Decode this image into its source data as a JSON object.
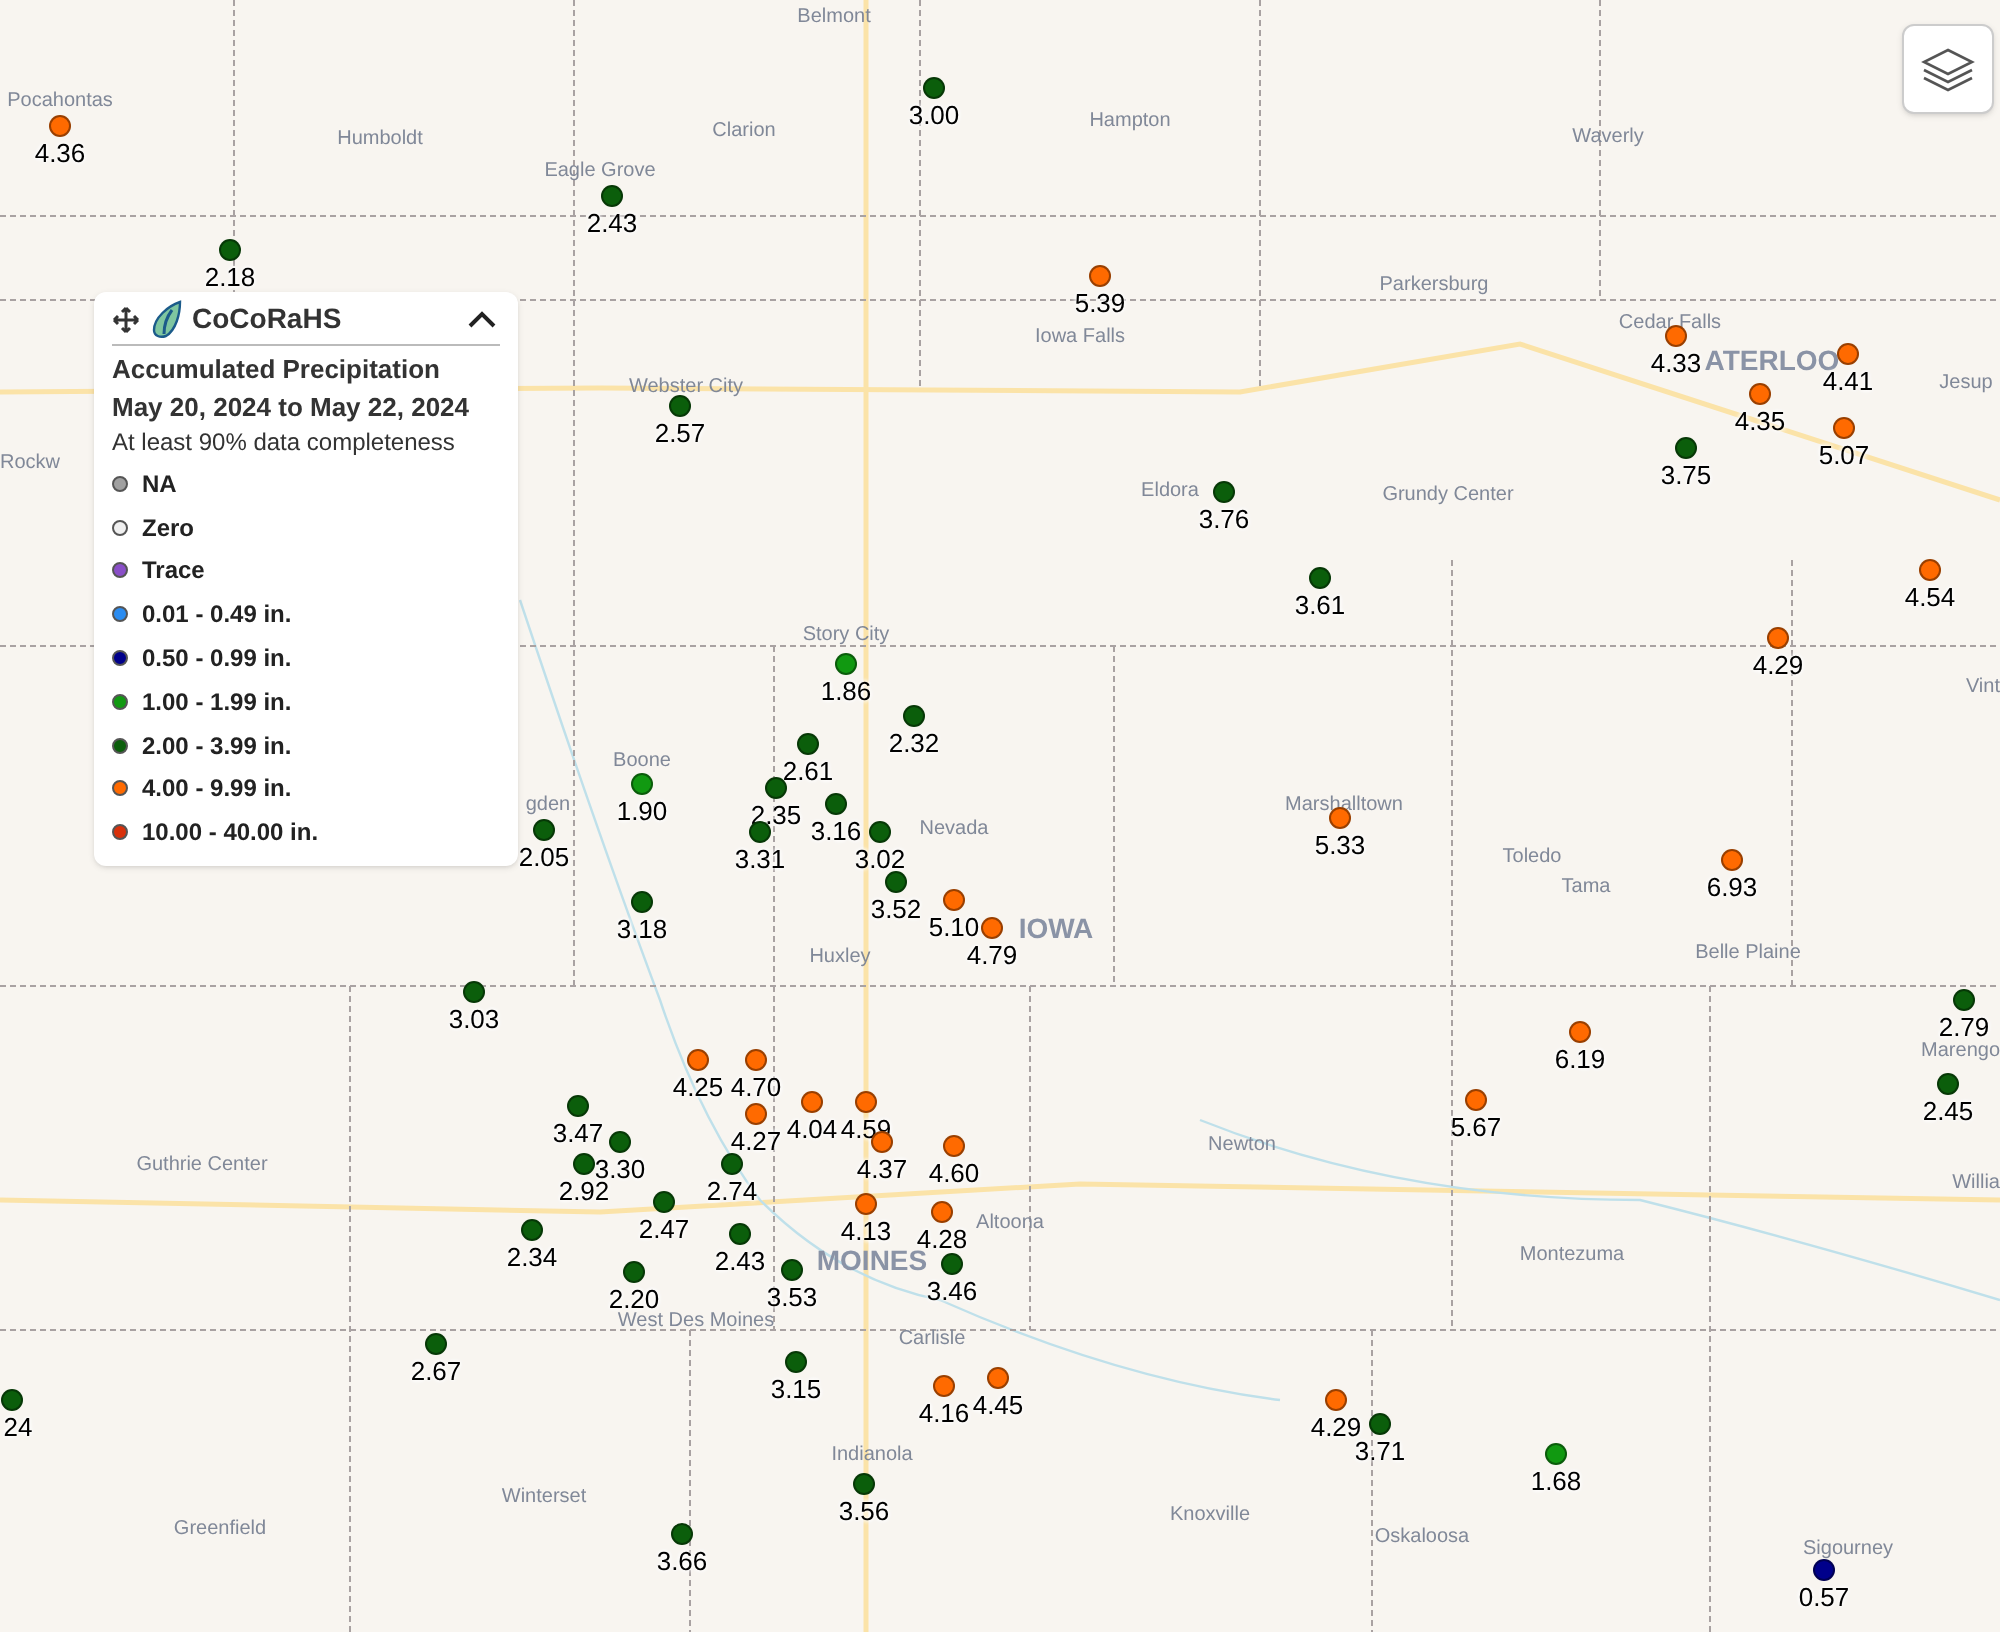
{
  "legend": {
    "brand": "CoCoRaHS",
    "expanded": true,
    "title": "Accumulated Precipitation",
    "dates": "May 20, 2024 to May 22, 2024",
    "note": "At least 90% data completeness",
    "items": [
      {
        "label": "NA",
        "color": "#a0a0a0"
      },
      {
        "label": "Zero",
        "color": "#f0f0f0"
      },
      {
        "label": "Trace",
        "color": "#8a4fc8"
      },
      {
        "label": "0.01 - 0.49 in.",
        "color": "#2b8cf0"
      },
      {
        "label": "0.50 - 0.99 in.",
        "color": "#00008b"
      },
      {
        "label": "1.00 - 1.99 in.",
        "color": "#119911"
      },
      {
        "label": "2.00 - 3.99 in.",
        "color": "#0b5e0b"
      },
      {
        "label": "4.00 - 9.99 in.",
        "color": "#ff6a00"
      },
      {
        "label": "10.00 - 40.00 in.",
        "color": "#d8300a"
      }
    ]
  },
  "towns": [
    {
      "name": "Belmont",
      "kind": "town"
    },
    {
      "name": "Pocahontas",
      "kind": "town"
    },
    {
      "name": "Humboldt",
      "kind": "town"
    },
    {
      "name": "Clarion",
      "kind": "town"
    },
    {
      "name": "Hampton",
      "kind": "town"
    },
    {
      "name": "Waverly",
      "kind": "town"
    },
    {
      "name": "Eagle Grove",
      "kind": "town"
    },
    {
      "name": "Parkersburg",
      "kind": "town"
    },
    {
      "name": "Iowa Falls",
      "kind": "town"
    },
    {
      "name": "Cedar Falls",
      "kind": "town"
    },
    {
      "name": "ATERLOO",
      "kind": "city"
    },
    {
      "name": "Webster City",
      "kind": "town"
    },
    {
      "name": "Jesup",
      "kind": "town"
    },
    {
      "name": "Rockw",
      "kind": "town"
    },
    {
      "name": "Eldora",
      "kind": "town"
    },
    {
      "name": "Grundy Center",
      "kind": "town"
    },
    {
      "name": "Story City",
      "kind": "town"
    },
    {
      "name": "Vint",
      "kind": "town"
    },
    {
      "name": "Boone",
      "kind": "town"
    },
    {
      "name": "gden",
      "kind": "town"
    },
    {
      "name": "Nevada",
      "kind": "town"
    },
    {
      "name": "Marshalltown",
      "kind": "town"
    },
    {
      "name": "Toledo",
      "kind": "town"
    },
    {
      "name": "Tama",
      "kind": "town"
    },
    {
      "name": "IOWA",
      "kind": "city"
    },
    {
      "name": "Huxley",
      "kind": "town"
    },
    {
      "name": "Belle Plaine",
      "kind": "town"
    },
    {
      "name": "Marengo",
      "kind": "town"
    },
    {
      "name": "Guthrie Center",
      "kind": "town"
    },
    {
      "name": "Newton",
      "kind": "town"
    },
    {
      "name": "Willia",
      "kind": "town"
    },
    {
      "name": "Altoona",
      "kind": "town"
    },
    {
      "name": "MOINES",
      "kind": "city"
    },
    {
      "name": "Montezuma",
      "kind": "town"
    },
    {
      "name": "West Des Moines",
      "kind": "town"
    },
    {
      "name": "Carlisle",
      "kind": "town"
    },
    {
      "name": "Indianola",
      "kind": "town"
    },
    {
      "name": "Winterset",
      "kind": "town"
    },
    {
      "name": "Greenfield",
      "kind": "town"
    },
    {
      "name": "Knoxville",
      "kind": "town"
    },
    {
      "name": "Oskaloosa",
      "kind": "town"
    },
    {
      "name": "Sigourney",
      "kind": "town"
    }
  ],
  "stations": [
    {
      "value": "3.00",
      "color": "#0b5e0b"
    },
    {
      "value": "4.36",
      "color": "#ff6a00"
    },
    {
      "value": "2.43",
      "color": "#0b5e0b"
    },
    {
      "value": "2.18",
      "color": "#0b5e0b"
    },
    {
      "value": "5.39",
      "color": "#ff6a00"
    },
    {
      "value": "4.33",
      "color": "#ff6a00"
    },
    {
      "value": "4.41",
      "color": "#ff6a00"
    },
    {
      "value": "2.57",
      "color": "#0b5e0b"
    },
    {
      "value": "4.35",
      "color": "#ff6a00"
    },
    {
      "value": "3.75",
      "color": "#0b5e0b"
    },
    {
      "value": "5.07",
      "color": "#ff6a00"
    },
    {
      "value": "3.76",
      "color": "#0b5e0b"
    },
    {
      "value": "3.61",
      "color": "#0b5e0b"
    },
    {
      "value": "4.54",
      "color": "#ff6a00"
    },
    {
      "value": "4.29",
      "color": "#ff6a00"
    },
    {
      "value": "1.86",
      "color": "#119911"
    },
    {
      "value": "2.32",
      "color": "#0b5e0b"
    },
    {
      "value": "2.61",
      "color": "#0b5e0b"
    },
    {
      "value": "1.90",
      "color": "#119911"
    },
    {
      "value": "2.35",
      "color": "#0b5e0b"
    },
    {
      "value": "2.05",
      "color": "#0b5e0b"
    },
    {
      "value": "3.31",
      "color": "#0b5e0b"
    },
    {
      "value": "3.16",
      "color": "#0b5e0b"
    },
    {
      "value": "3.02",
      "color": "#0b5e0b"
    },
    {
      "value": "5.33",
      "color": "#ff6a00"
    },
    {
      "value": "6.93",
      "color": "#ff6a00"
    },
    {
      "value": "3.52",
      "color": "#0b5e0b"
    },
    {
      "value": "3.18",
      "color": "#0b5e0b"
    },
    {
      "value": "5.10",
      "color": "#ff6a00"
    },
    {
      "value": "4.79",
      "color": "#ff6a00"
    },
    {
      "value": "3.03",
      "color": "#0b5e0b"
    },
    {
      "value": "2.79",
      "color": "#0b5e0b"
    },
    {
      "value": "6.19",
      "color": "#ff6a00"
    },
    {
      "value": "4.25",
      "color": "#ff6a00"
    },
    {
      "value": "4.70",
      "color": "#ff6a00"
    },
    {
      "value": "3.47",
      "color": "#0b5e0b"
    },
    {
      "value": "4.27",
      "color": "#ff6a00"
    },
    {
      "value": "4.04",
      "color": "#ff6a00"
    },
    {
      "value": "4.59",
      "color": "#ff6a00"
    },
    {
      "value": "5.67",
      "color": "#ff6a00"
    },
    {
      "value": "2.45",
      "color": "#0b5e0b"
    },
    {
      "value": "3.30",
      "color": "#0b5e0b"
    },
    {
      "value": "4.37",
      "color": "#ff6a00"
    },
    {
      "value": "4.60",
      "color": "#ff6a00"
    },
    {
      "value": "2.92",
      "color": "#0b5e0b"
    },
    {
      "value": "2.74",
      "color": "#0b5e0b"
    },
    {
      "value": "2.47",
      "color": "#0b5e0b"
    },
    {
      "value": "4.13",
      "color": "#ff6a00"
    },
    {
      "value": "4.28",
      "color": "#ff6a00"
    },
    {
      "value": "2.34",
      "color": "#0b5e0b"
    },
    {
      "value": "2.43",
      "color": "#0b5e0b"
    },
    {
      "value": "2.20",
      "color": "#0b5e0b"
    },
    {
      "value": "3.53",
      "color": "#0b5e0b"
    },
    {
      "value": "3.46",
      "color": "#0b5e0b"
    },
    {
      "value": "2.67",
      "color": "#0b5e0b"
    },
    {
      "value": "3.15",
      "color": "#0b5e0b"
    },
    {
      "value": "4.16",
      "color": "#ff6a00"
    },
    {
      "value": "4.45",
      "color": "#ff6a00"
    },
    {
      "value": "24",
      "color": "#0b5e0b"
    },
    {
      "value": "4.29",
      "color": "#ff6a00"
    },
    {
      "value": "3.71",
      "color": "#0b5e0b"
    },
    {
      "value": "1.68",
      "color": "#119911"
    },
    {
      "value": "3.56",
      "color": "#0b5e0b"
    },
    {
      "value": "3.66",
      "color": "#0b5e0b"
    },
    {
      "value": "0.57",
      "color": "#00008b"
    }
  ]
}
